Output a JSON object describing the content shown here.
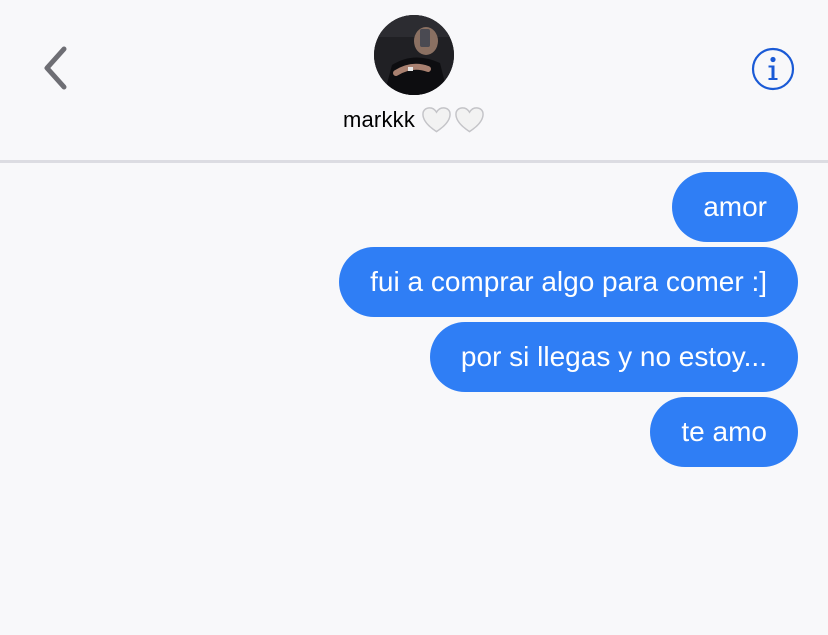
{
  "header": {
    "back_icon": "chevron-left-icon",
    "contact_name": "markkk",
    "hearts": "🤍🤍",
    "info_icon": "info-icon",
    "accent_color": "#1a5ad6"
  },
  "messages": [
    {
      "text": "amor",
      "sender": "me"
    },
    {
      "text": "fui a comprar algo para comer :]",
      "sender": "me"
    },
    {
      "text": "por si llegas y no estoy...",
      "sender": "me"
    },
    {
      "text": "te amo",
      "sender": "me"
    }
  ],
  "colors": {
    "bubble": "#2f7ef5",
    "background": "#f8f8fa"
  }
}
